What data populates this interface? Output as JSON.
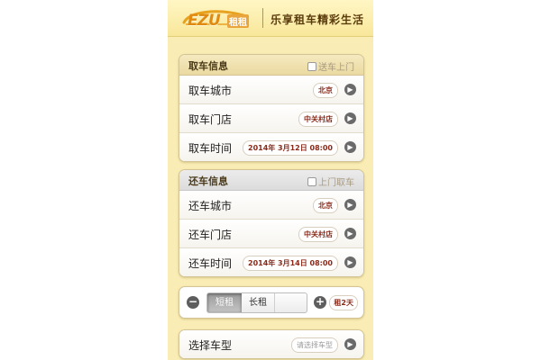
{
  "header": {
    "logo_main": "EZU",
    "logo_sub": "租租",
    "slogan": "乐享租车精彩生活"
  },
  "pickup": {
    "title": "取车信息",
    "option_label": "送车上门",
    "rows": [
      {
        "label": "取车城市",
        "value": "北京"
      },
      {
        "label": "取车门店",
        "value": "中关村店"
      },
      {
        "label": "取车时间",
        "value": "2014年 3月12日 08:00"
      }
    ]
  },
  "return": {
    "title": "还车信息",
    "option_label": "上门取车",
    "rows": [
      {
        "label": "还车城市",
        "value": "北京"
      },
      {
        "label": "还车门店",
        "value": "中关村店"
      },
      {
        "label": "还车时间",
        "value": "2014年 3月14日 08:00"
      }
    ]
  },
  "rental_type": {
    "minus": "−",
    "plus": "+",
    "options": [
      "短租",
      "长租"
    ],
    "selected": "短租",
    "duration": "租2天"
  },
  "car_model": {
    "label": "选择车型",
    "placeholder": "请选择车型"
  },
  "icons": {
    "logo": "car-silhouette-icon",
    "checkbox": "checkbox-icon",
    "row_arrow": "chevron-right-icon"
  },
  "colors": {
    "background": "#f9edb5",
    "accent": "#e08a12",
    "value_text": "#8a2a1a"
  }
}
